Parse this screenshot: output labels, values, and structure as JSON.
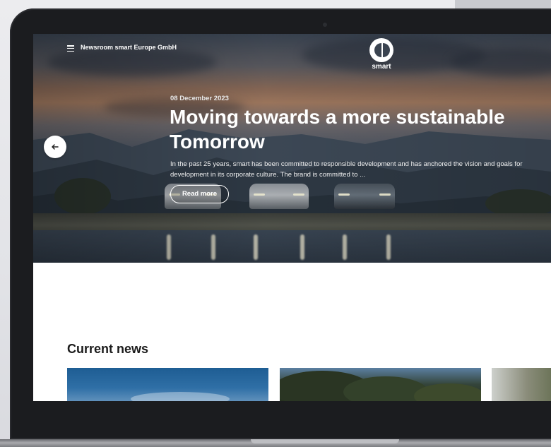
{
  "header": {
    "brand_text": "Newsroom smart Europe GmbH",
    "logo_text": "smart",
    "menu_icon": "hamburger-menu-icon"
  },
  "hero": {
    "date": "08 December 2023",
    "headline": "Moving towards a more sustainable Tomorrow",
    "summary": "In the past 25 years, smart has been committed to responsible development and has anchored the vision and goals for development in its corporate culture. The brand is committed to ...",
    "read_more_label": "Read more",
    "prev_icon": "arrow-left-icon"
  },
  "news": {
    "section_title": "Current news"
  },
  "colors": {
    "bezel": "#1b1c1f",
    "text_light": "#ffffff",
    "text_dark": "#1b1b1b"
  }
}
